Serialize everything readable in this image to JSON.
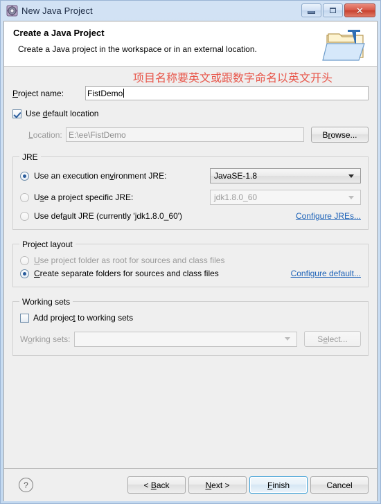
{
  "window": {
    "title": "New Java Project",
    "icon": "new-java-project-icon",
    "controls": {
      "minimize": "minimize-icon",
      "maximize": "maximize-icon",
      "close": "✕"
    }
  },
  "banner": {
    "title": "Create a Java Project",
    "description": "Create a Java project in the workspace or in an external location.",
    "icon": "java-project-folder-icon"
  },
  "annotation": {
    "text": "项目名称要英文或跟数字命名以英文开头",
    "color": "#e8564a"
  },
  "project_name": {
    "label": "Project name:",
    "value": "FistDemo",
    "placeholder": ""
  },
  "use_default_location": {
    "label": "Use default location",
    "checked": true
  },
  "location": {
    "label": "Location:",
    "value": "E:\\ee\\FistDemo",
    "browse_label": "Browse..."
  },
  "jre": {
    "group_title": "JRE",
    "options": [
      {
        "label": "Use an execution environment JRE:",
        "selected": true,
        "combo_value": "JavaSE-1.8",
        "combo_enabled": true
      },
      {
        "label": "Use a project specific JRE:",
        "selected": false,
        "combo_value": "jdk1.8.0_60",
        "combo_enabled": false
      },
      {
        "label": "Use default JRE (currently 'jdk1.8.0_60')",
        "selected": false
      }
    ],
    "configure_link": "Configure JREs..."
  },
  "project_layout": {
    "group_title": "Project layout",
    "options": [
      {
        "label": "Use project folder as root for sources and class files",
        "selected": false
      },
      {
        "label": "Create separate folders for sources and class files",
        "selected": true
      }
    ],
    "configure_link": "Configure default..."
  },
  "working_sets": {
    "group_title": "Working sets",
    "add_label": "Add project to working sets",
    "add_checked": false,
    "sets_label": "Working sets:",
    "sets_value": "",
    "select_label": "Select..."
  },
  "buttons": {
    "help": "?",
    "back": "< Back",
    "next": "Next >",
    "finish": "Finish",
    "cancel": "Cancel"
  }
}
